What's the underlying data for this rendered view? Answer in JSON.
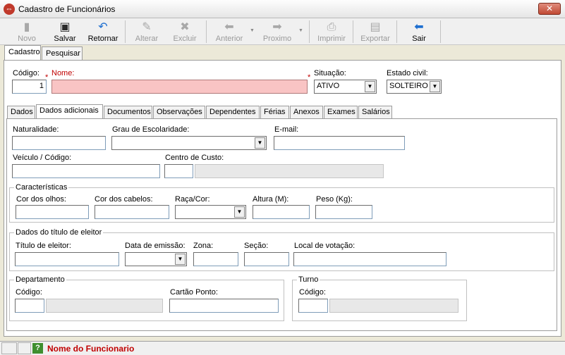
{
  "window": {
    "title": "Cadastro de Funcionários",
    "close_label": "✕"
  },
  "toolbar": {
    "novo": "Novo",
    "salvar": "Salvar",
    "retornar": "Retornar",
    "alterar": "Alterar",
    "excluir": "Excluir",
    "anterior": "Anterior",
    "proximo": "Proximo",
    "imprimir": "Imprimir",
    "exportar": "Exportar",
    "sair": "Sair"
  },
  "outer_tabs": [
    "Cadastro",
    "Pesquisar"
  ],
  "header": {
    "codigo_label": "Código:",
    "codigo_value": "1",
    "nome_label": "Nome:",
    "nome_value": "",
    "situacao_label": "Situação:",
    "situacao_value": "ATIVO",
    "estado_civil_label": "Estado civil:",
    "estado_civil_value": "SOLTEIRO",
    "required_mark": "*"
  },
  "inner_tabs": [
    "Dados",
    "Dados adicionais",
    "Documentos",
    "Observações",
    "Dependentes",
    "Férias",
    "Anexos",
    "Exames",
    "Salários"
  ],
  "dados_adicionais": {
    "naturalidade_label": "Naturalidade:",
    "escolaridade_label": "Grau de Escolaridade:",
    "email_label": "E-mail:",
    "veiculo_label": "Veículo / Código:",
    "centro_custo_label": "Centro de Custo:"
  },
  "caracteristicas": {
    "title": "Características",
    "olhos_label": "Cor dos olhos:",
    "cabelos_label": "Cor dos cabelos:",
    "raca_label": "Raça/Cor:",
    "altura_label": "Altura (M):",
    "peso_label": "Peso (Kg):"
  },
  "eleitor": {
    "title": "Dados do título de eleitor",
    "titulo_label": "Título de eleitor:",
    "data_label": "Data de emissão:",
    "zona_label": "Zona:",
    "secao_label": "Seção:",
    "local_label": "Local de votação:"
  },
  "departamento": {
    "title": "Departamento",
    "codigo_label": "Código:",
    "cartao_label": "Cartão Ponto:"
  },
  "turno": {
    "title": "Turno",
    "codigo_label": "Código:"
  },
  "statusbar": {
    "help_icon": "?",
    "message": "Nome do Funcionario"
  }
}
